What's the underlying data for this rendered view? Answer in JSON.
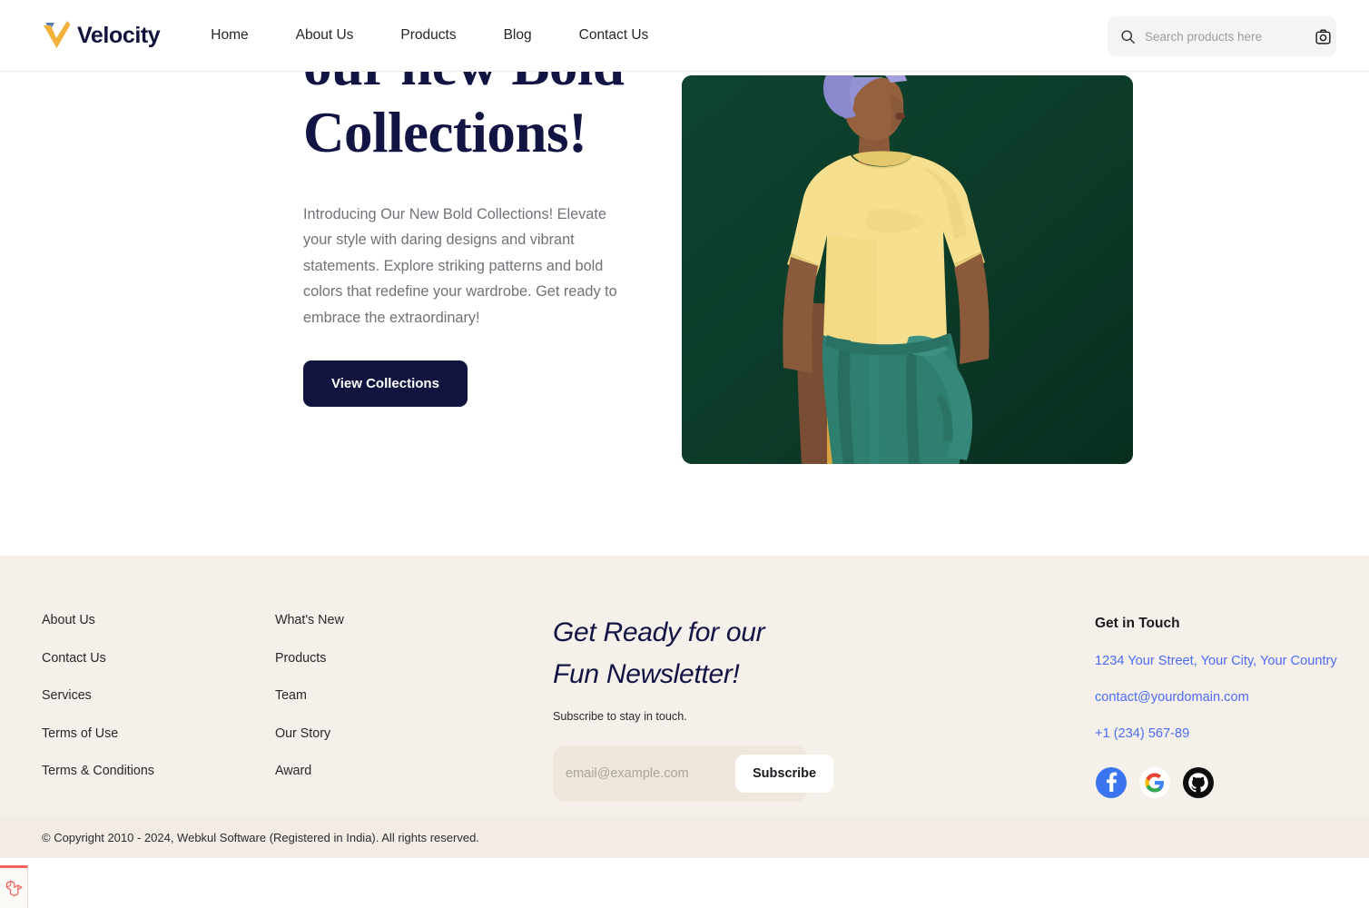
{
  "header": {
    "brand": {
      "name": "Velocity",
      "logo_icon": "velocity-v-checkmark-logo"
    },
    "nav": [
      {
        "label": "Home"
      },
      {
        "label": "About Us"
      },
      {
        "label": "Products"
      },
      {
        "label": "Blog"
      },
      {
        "label": "Contact Us"
      }
    ],
    "search": {
      "placeholder": "Search products here",
      "value": "",
      "search_icon": "search-icon",
      "camera_icon": "camera-icon"
    }
  },
  "hero": {
    "title_line1": "our new Bold",
    "title_line2": "Collections!",
    "description": "Introducing Our New Bold Collections! Elevate your style with daring designs and vibrant statements. Explore striking patterns and bold colors that redefine your wardrobe. Get ready to embrace the extraordinary!",
    "cta_label": "View Collections",
    "image_alt": "Model in yellow t-shirt with lavender hat and teal jacket tied at waist against dark green backdrop",
    "image_colors": {
      "background": "#0c3b28",
      "shirt": "#f5dd8a",
      "hat": "#8f8ed0",
      "jacket": "#2e7d6e",
      "pants": "#d8a43f",
      "skin": "#8a5a3b"
    }
  },
  "footer": {
    "link_columns": [
      {
        "links": [
          {
            "label": "About Us"
          },
          {
            "label": "Contact Us"
          },
          {
            "label": "Services"
          },
          {
            "label": "Terms of Use"
          },
          {
            "label": "Terms & Conditions"
          }
        ]
      },
      {
        "links": [
          {
            "label": "What's New"
          },
          {
            "label": "Products"
          },
          {
            "label": "Team"
          },
          {
            "label": "Our Story"
          },
          {
            "label": "Award"
          }
        ]
      }
    ],
    "newsletter": {
      "title_line1": "Get Ready for our",
      "title_line2": "Fun Newsletter!",
      "subtitle": "Subscribe to stay in touch.",
      "email_placeholder": "email@example.com",
      "email_value": "",
      "subscribe_label": "Subscribe"
    },
    "contact": {
      "title": "Get in Touch",
      "address": "1234 Your Street, Your City, Your Country",
      "email": "contact@yourdomain.com",
      "phone": "+1 (234) 567-89",
      "socials": [
        {
          "name": "facebook-icon"
        },
        {
          "name": "google-icon"
        },
        {
          "name": "github-icon"
        }
      ]
    },
    "copyright": "© Copyright 2010 - 2024, Webkul Software (Registered in India). All rights reserved.",
    "debug_badge_icon": "laravel-icon"
  },
  "colors": {
    "brand_navy": "#10143c",
    "accent_yellow": "#f2b13b",
    "accent_blue_mark": "#4f7fb5",
    "footer_bg": "#f5f0ea",
    "link_blue": "#4b6cf5",
    "hero_green": "#0c3b28"
  }
}
